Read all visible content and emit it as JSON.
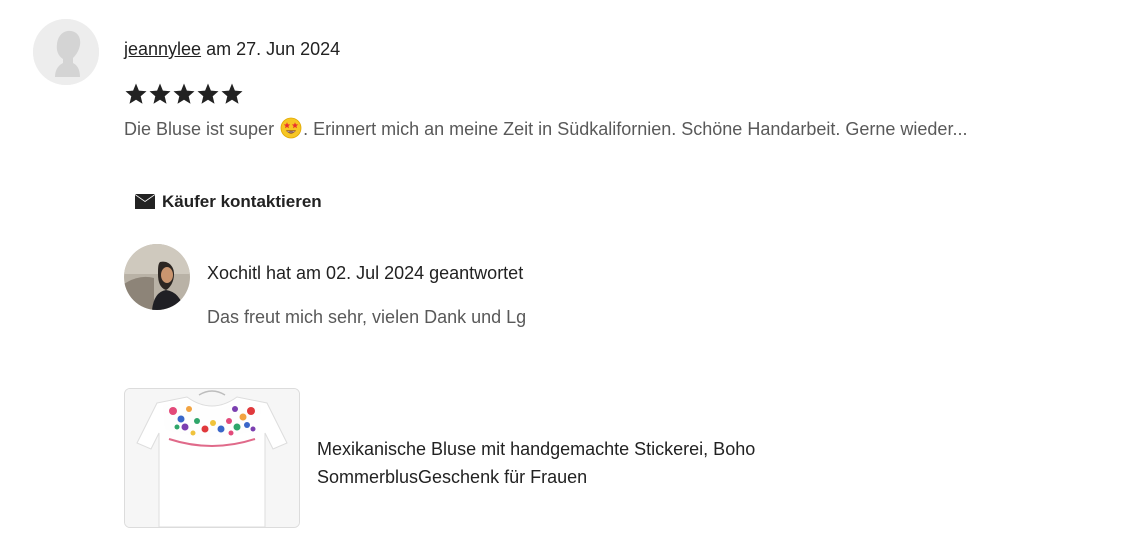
{
  "review": {
    "reviewer_name": "jeannylee",
    "date_text": "am 27. Jun 2024",
    "rating": 5,
    "rating_max": 5,
    "text_before_emoji": "Die Bluse ist super",
    "emoji_icon": "star-struck-face-emoji",
    "text_after_emoji": ". Erinnert mich an meine Zeit in Südkalifornien. Schöne Handarbeit. Gerne wieder..."
  },
  "contact_button": {
    "label": "Käufer kontaktieren",
    "icon": "mail-icon"
  },
  "seller_response": {
    "header": "Xochitl hat am 02. Jul 2024 geantwortet",
    "text": "Das freut mich sehr, vielen Dank und Lg"
  },
  "product": {
    "title": "Mexikanische Bluse mit handgemachte Stickerei, Boho SommerblusGeschenk für Frauen",
    "image_icon": "embroidered-blouse-thumbnail"
  },
  "colors": {
    "text_primary": "#222222",
    "text_secondary": "#595959",
    "star": "#222222",
    "border": "#dcdcdc"
  }
}
